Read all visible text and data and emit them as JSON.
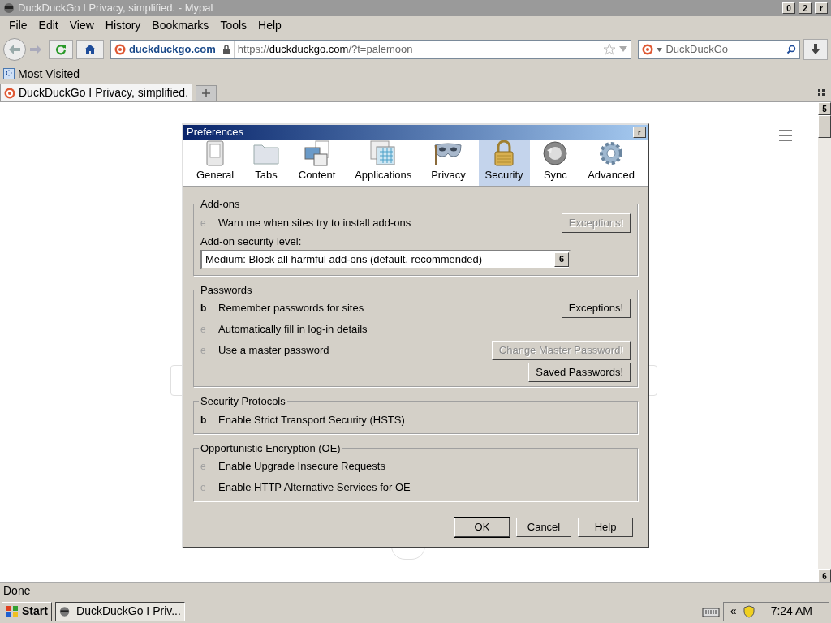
{
  "window": {
    "title": "DuckDuckGo I Privacy, simplified. - Mypal",
    "controls": [
      "0",
      "2",
      "r"
    ]
  },
  "menu": [
    "File",
    "Edit",
    "View",
    "History",
    "Bookmarks",
    "Tools",
    "Help"
  ],
  "toolbar": {
    "site": "duckduckgo.com",
    "url_prefix": "https://",
    "url_host": "duckduckgo.com",
    "url_rest": "/?t=palemoon",
    "search_placeholder": "DuckDuckGo"
  },
  "bookmarks": [
    {
      "label": "Most Visited"
    }
  ],
  "tabs": [
    {
      "label": "DuckDuckGo I Privacy, simplified.",
      "selected": true
    }
  ],
  "scrollbar": {
    "up": "5",
    "down": "6"
  },
  "dialog": {
    "title": "Preferences",
    "close": "r",
    "panes": [
      {
        "label": "General",
        "kind": "switch",
        "selected": false
      },
      {
        "label": "Tabs",
        "kind": "folder",
        "selected": false
      },
      {
        "label": "Content",
        "kind": "content",
        "selected": false
      },
      {
        "label": "Applications",
        "kind": "apps",
        "selected": false
      },
      {
        "label": "Privacy",
        "kind": "mask",
        "selected": false
      },
      {
        "label": "Security",
        "kind": "lock",
        "selected": true
      },
      {
        "label": "Sync",
        "kind": "sync",
        "selected": false
      },
      {
        "label": "Advanced",
        "kind": "gear",
        "selected": false
      }
    ],
    "groups": [
      {
        "title": "Add-ons",
        "rows": [
          {
            "kind": "check",
            "mark": "e",
            "label": "Warn me when sites try to install add-ons",
            "checked": false,
            "buttons": [
              {
                "label": "Exceptions!",
                "disabled": true
              }
            ]
          },
          {
            "kind": "label",
            "label": "Add-on security level:"
          },
          {
            "kind": "select",
            "value": "Medium: Block all harmful add-ons (default, recommended)",
            "arrow": "6"
          }
        ]
      },
      {
        "title": "Passwords",
        "rows": [
          {
            "kind": "check",
            "mark": "b",
            "label": "Remember passwords for sites",
            "checked": true,
            "buttons": [
              {
                "label": "Exceptions!",
                "disabled": false
              }
            ]
          },
          {
            "kind": "check",
            "mark": "e",
            "label": "Automatically fill in log-in details",
            "checked": false
          },
          {
            "kind": "check",
            "mark": "e",
            "label": "Use a master password",
            "checked": false,
            "buttons": [
              {
                "label": "Change Master Password!",
                "disabled": true
              }
            ]
          },
          {
            "kind": "buttons",
            "buttons": [
              {
                "label": "Saved Passwords!",
                "disabled": false
              }
            ]
          }
        ]
      },
      {
        "title": "Security Protocols",
        "rows": [
          {
            "kind": "check",
            "mark": "b",
            "label": "Enable Strict Transport Security (HSTS)",
            "checked": true
          }
        ]
      },
      {
        "title": "Opportunistic Encryption (OE)",
        "rows": [
          {
            "kind": "check",
            "mark": "e",
            "label": "Enable Upgrade Insecure Requests",
            "checked": false
          },
          {
            "kind": "check",
            "mark": "e",
            "label": "Enable HTTP Alternative Services for OE",
            "checked": false
          }
        ]
      }
    ],
    "buttons": [
      "OK",
      "Cancel",
      "Help"
    ]
  },
  "status_bar": {
    "text": "Done"
  },
  "taskbar": {
    "start": "Start",
    "task": "DuckDuckGo I Priv...",
    "tray_arrow": "«",
    "time": "7:24 AM"
  }
}
